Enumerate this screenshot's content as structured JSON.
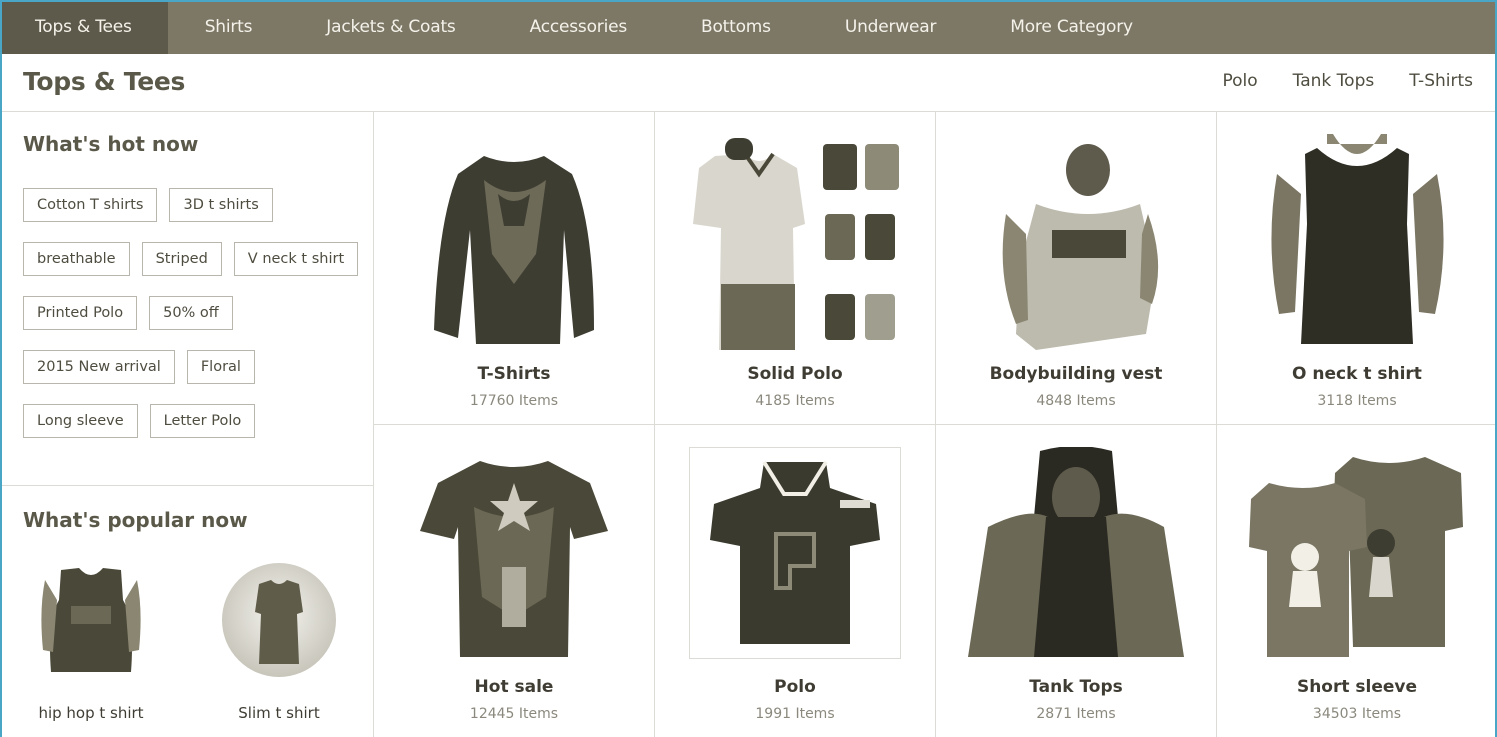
{
  "nav": {
    "items": [
      "Tops & Tees",
      "Shirts",
      "Jackets & Coats",
      "Accessories",
      "Bottoms",
      "Underwear",
      "More Category"
    ],
    "active": "Tops & Tees"
  },
  "header": {
    "title": "Tops & Tees",
    "links": [
      "Polo",
      "Tank Tops",
      "T-Shirts"
    ]
  },
  "sidebar": {
    "hot_title": "What's hot now",
    "tag_rows": [
      [
        "Cotton T shirts",
        "3D t shirts"
      ],
      [
        "breathable",
        "Striped",
        "V neck t shirt"
      ],
      [
        "Printed Polo",
        "50% off"
      ],
      [
        "2015 New arrival",
        "Floral"
      ],
      [
        "Long sleeve",
        "Letter Polo"
      ]
    ],
    "popular_title": "What's popular now",
    "popular": [
      {
        "label": "hip hop t shirt"
      },
      {
        "label": "Slim t shirt"
      }
    ]
  },
  "products": [
    {
      "title": "T-Shirts",
      "count": "17760 Items",
      "icon": "long-sleeve-shirt-icon"
    },
    {
      "title": "Solid Polo",
      "count": "4185 Items",
      "icon": "polo-shirt-icon"
    },
    {
      "title": "Bodybuilding vest",
      "count": "4848 Items",
      "icon": "vest-icon"
    },
    {
      "title": "O neck t shirt",
      "count": "3118 Items",
      "icon": "tank-top-icon"
    },
    {
      "title": "Hot sale",
      "count": "12445 Items",
      "icon": "tshirt-icon"
    },
    {
      "title": "Polo",
      "count": "1991 Items",
      "icon": "polo-shirt-icon"
    },
    {
      "title": "Tank Tops",
      "count": "2871 Items",
      "icon": "hooded-tank-icon"
    },
    {
      "title": "Short sleeve",
      "count": "34503 Items",
      "icon": "tshirt-icon"
    }
  ],
  "colors": {
    "nav_bg": "#7d7866",
    "nav_active_bg": "#5e5a4b",
    "text": "#4f4d40",
    "muted": "#8b897d",
    "border": "#dcdbd6",
    "frame": "#4aa6c7"
  }
}
